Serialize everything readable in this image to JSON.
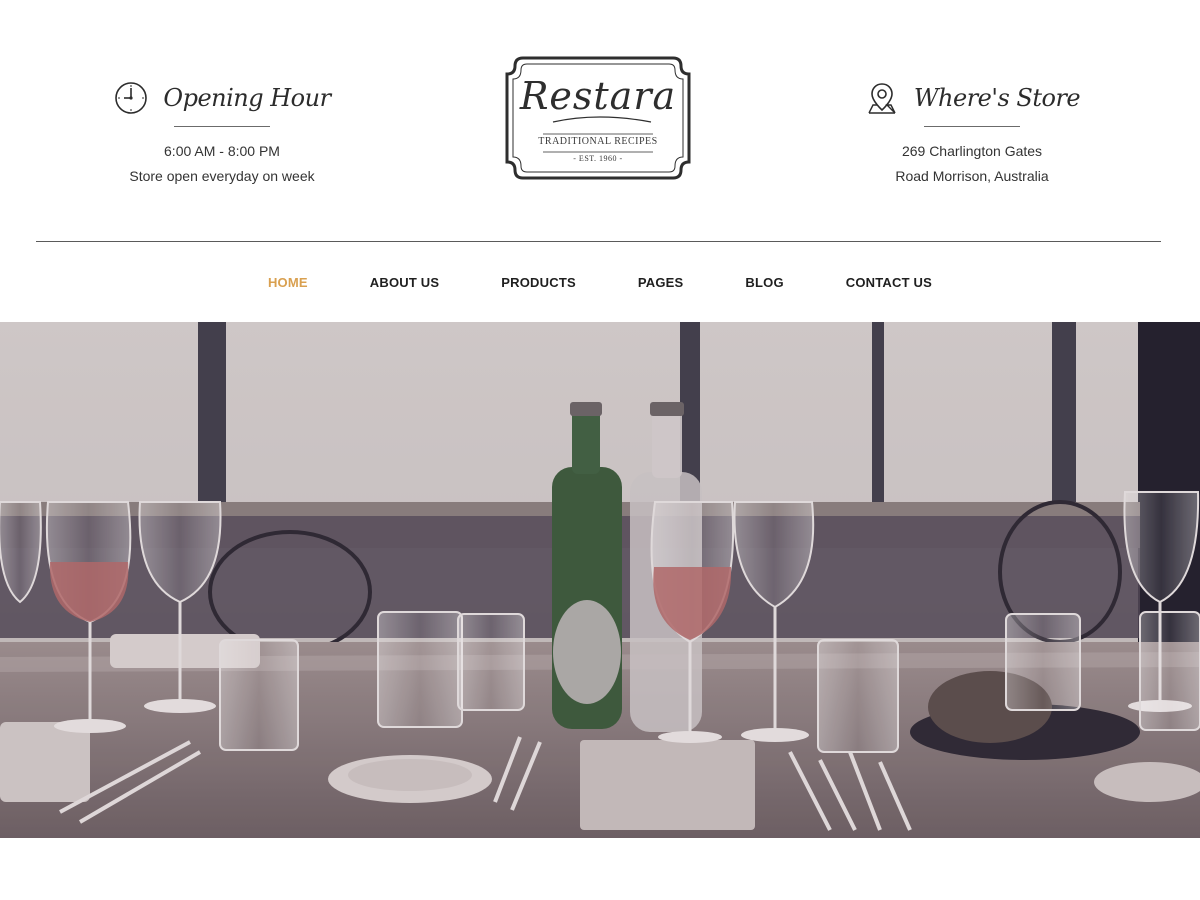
{
  "header": {
    "opening": {
      "icon": "clock-icon",
      "title": "Opening Hour",
      "lines": [
        "6:00 AM - 8:00 PM",
        "Store open everyday on week"
      ]
    },
    "logo": {
      "name": "Restara",
      "tagline": "TRADITIONAL RECIPES",
      "established": "- EST. 1960 -"
    },
    "store": {
      "icon": "map-pin-icon",
      "title": "Where's Store",
      "lines": [
        "269 Charlington Gates",
        "Road Morrison, Australia"
      ]
    }
  },
  "nav": {
    "items": [
      {
        "label": "HOME",
        "active": true
      },
      {
        "label": "ABOUT US",
        "active": false
      },
      {
        "label": "PRODUCTS",
        "active": false
      },
      {
        "label": "PAGES",
        "active": false
      },
      {
        "label": "BLOG",
        "active": false
      },
      {
        "label": "CONTACT US",
        "active": false
      }
    ]
  },
  "hero": {
    "image": "restaurant-table-photo"
  },
  "colors": {
    "accent": "#d9a050",
    "text": "#333333",
    "nav_text": "#1f1f1f",
    "rule": "#5a5a5a"
  }
}
